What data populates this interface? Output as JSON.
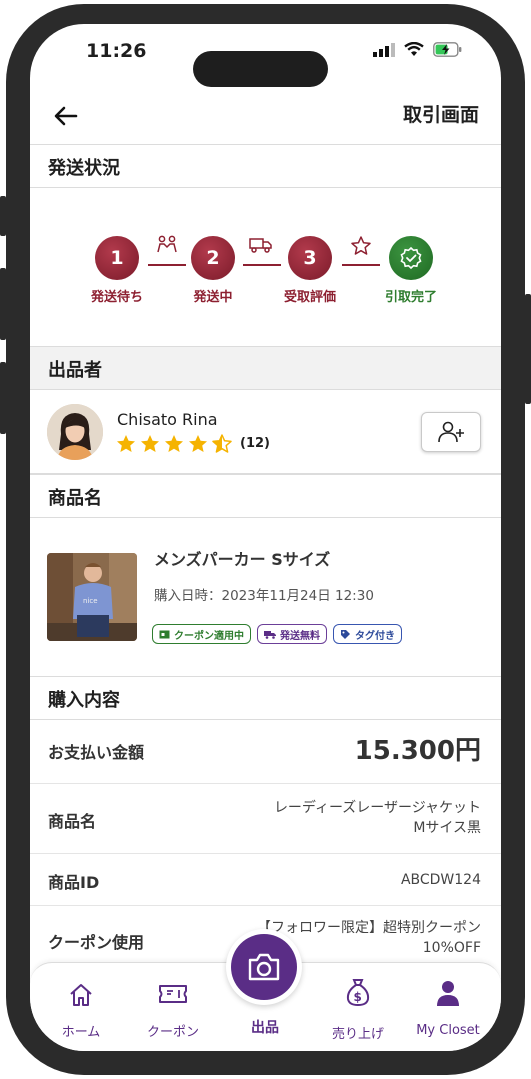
{
  "status_bar": {
    "time": "11:26"
  },
  "header": {
    "title": "取引画面"
  },
  "shipping": {
    "section_title": "発送状況",
    "steps": [
      {
        "number": "1",
        "label": "発送待ち",
        "state": "done"
      },
      {
        "number": "2",
        "label": "発送中",
        "state": "done"
      },
      {
        "number": "3",
        "label": "受取評価",
        "state": "done"
      },
      {
        "number": "",
        "label": "引取完了",
        "state": "complete"
      }
    ],
    "connector_icons": [
      "people-icon",
      "truck-icon",
      "star-outline-icon"
    ]
  },
  "seller": {
    "section_title": "出品者",
    "name": "Chisato Rina",
    "rating": 4.5,
    "review_count": "(12)"
  },
  "product": {
    "section_title": "商品名",
    "name": "メンズパーカー Sサイズ",
    "purchase_date": "購入日時：2023年11月24日 12:30",
    "tags": [
      {
        "label": "クーポン適用中",
        "icon": "coupon-icon",
        "color": "#2f7d2f"
      },
      {
        "label": "発送無料",
        "icon": "truck-icon",
        "color": "#5a2d86"
      },
      {
        "label": "タグ付き",
        "icon": "tag-icon",
        "color": "#2d4a9a"
      }
    ]
  },
  "purchase": {
    "section_title": "購入内容",
    "payment_label": "お支払い金額",
    "payment_value": "15.300円",
    "item_name_label": "商品名",
    "item_name_line1": "レーディーズレーザージャケット",
    "item_name_line2": "Mサイス黒",
    "item_id_label": "商品ID",
    "item_id_value": "ABCDW124",
    "coupon_label": "クーポン使用",
    "coupon_line1": "【フォロワー限定】超特別クーポン",
    "coupon_line2": "10%OFF"
  },
  "tabbar": {
    "items": [
      {
        "label": "ホーム",
        "icon": "home-icon"
      },
      {
        "label": "クーポン",
        "icon": "ticket-icon"
      },
      {
        "label": "出品",
        "icon": "camera-icon"
      },
      {
        "label": "売り上げ",
        "icon": "money-bag-icon"
      },
      {
        "label": "My Closet",
        "icon": "user-icon"
      }
    ]
  },
  "colors": {
    "accent": "#5a2d86",
    "step_red": "#8d2031",
    "step_green": "#2f7d2f",
    "star": "#f5b301"
  }
}
